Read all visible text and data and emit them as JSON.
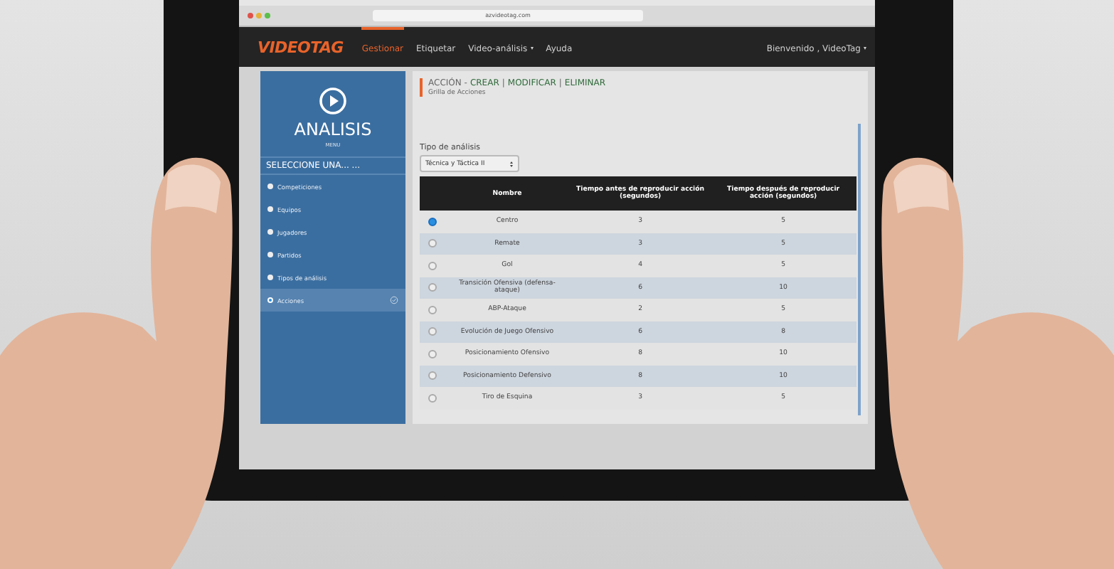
{
  "browser": {
    "url": "azvideotag.com"
  },
  "navbar": {
    "logo": "VIDEOTAG",
    "items": [
      {
        "label": "Gestionar",
        "selected": true,
        "dropdown": false
      },
      {
        "label": "Etiquetar",
        "selected": false,
        "dropdown": false
      },
      {
        "label": "Video-análisis",
        "selected": false,
        "dropdown": true
      },
      {
        "label": "Ayuda",
        "selected": false,
        "dropdown": false
      }
    ],
    "user": "Bienvenido , VideoTag"
  },
  "sidebar": {
    "title": "ANALISIS",
    "subtitle": "MENU",
    "section": "SELECCIONE UNA... ...",
    "items": [
      {
        "label": "Competiciones",
        "selected": false
      },
      {
        "label": "Equipos",
        "selected": false
      },
      {
        "label": "Jugadores",
        "selected": false
      },
      {
        "label": "Partidos",
        "selected": false
      },
      {
        "label": "Tipos de análisis",
        "selected": false
      },
      {
        "label": "Acciones",
        "selected": true
      }
    ]
  },
  "main": {
    "heading": "ACCIÓN - ",
    "separator": "|",
    "links": [
      "CREAR",
      "MODIFICAR",
      "ELIMINAR"
    ],
    "subtitle": "Grilla de Acciones",
    "filter": {
      "label": "Tipo de análisis",
      "value": "Técnica y Táctica II"
    },
    "table": {
      "columns": [
        "Nombre",
        "Tiempo antes de reproducir acción (segundos)",
        "Tiempo después de reproducir acción (segundos)"
      ],
      "rows": [
        {
          "selected": true,
          "name": "Centro",
          "before": "3",
          "after": "5"
        },
        {
          "selected": false,
          "name": "Remate",
          "before": "3",
          "after": "5"
        },
        {
          "selected": false,
          "name": "Gol",
          "before": "4",
          "after": "5"
        },
        {
          "selected": false,
          "name": "Transición Ofensiva (defensa-ataque)",
          "before": "6",
          "after": "10"
        },
        {
          "selected": false,
          "name": "ABP-Ataque",
          "before": "2",
          "after": "5"
        },
        {
          "selected": false,
          "name": "Evolución de Juego Ofensivo",
          "before": "6",
          "after": "8"
        },
        {
          "selected": false,
          "name": "Posicionamiento Ofensivo",
          "before": "8",
          "after": "10"
        },
        {
          "selected": false,
          "name": "Posicionamiento Defensivo",
          "before": "8",
          "after": "10"
        },
        {
          "selected": false,
          "name": "Tiro de Esquina",
          "before": "3",
          "after": "5"
        }
      ]
    }
  }
}
